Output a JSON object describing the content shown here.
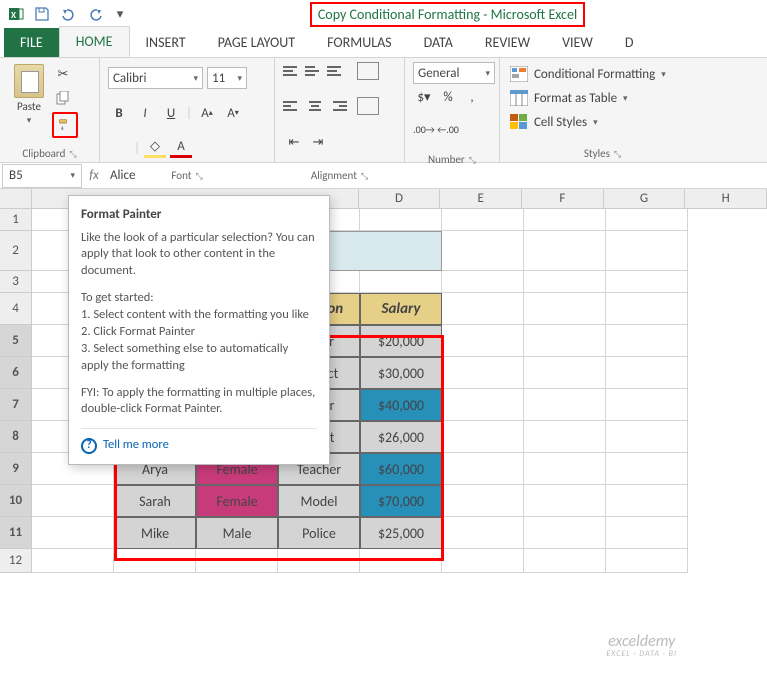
{
  "app": {
    "title": "Copy Conditional Formatting - Microsoft Excel"
  },
  "tabs": {
    "file": "FILE",
    "home": "HOME",
    "insert": "INSERT",
    "pagelayout": "PAGE LAYOUT",
    "formulas": "FORMULAS",
    "data": "DATA",
    "review": "REVIEW",
    "view": "VIEW",
    "d": "D"
  },
  "ribbon": {
    "paste": "Paste",
    "clipboard": "Clipboard",
    "font": "Font",
    "alignment": "Alignment",
    "number": "Number",
    "styles": "Styles",
    "fontname": "Calibri",
    "fontsize": "11",
    "numfmt": "General",
    "condfmt": "Conditional Formatting",
    "fmttable": "Format as Table",
    "cellstyles": "Cell Styles"
  },
  "fx": {
    "cellref": "B5",
    "value": "Alice"
  },
  "cols": [
    "D",
    "E",
    "F",
    "G",
    "H"
  ],
  "rownums": [
    "1",
    "2",
    "3",
    "4",
    "5",
    "6",
    "7",
    "8",
    "9",
    "10",
    "11",
    "12"
  ],
  "sheet": {
    "title": "Formatting",
    "headers": {
      "occ": "upation",
      "sal": "Salary"
    },
    "rows": [
      {
        "name": "",
        "gender": "",
        "occ": "octor",
        "sal": "$20,000"
      },
      {
        "name": "",
        "gender": "",
        "occ": "chitect",
        "sal": "$30,000"
      },
      {
        "name": "",
        "gender": "",
        "occ": "Actor",
        "sal": "$40,000",
        "salblue": true
      },
      {
        "name": "",
        "gender": "",
        "occ": "Artist",
        "sal": "$26,000"
      },
      {
        "name": "Arya",
        "gender": "Female",
        "genderpink": true,
        "occ": "Teacher",
        "sal": "$60,000",
        "salblue": true
      },
      {
        "name": "Sarah",
        "gender": "Female",
        "genderpink": true,
        "occ": "Model",
        "sal": "$70,000",
        "salblue": true
      },
      {
        "name": "Mike",
        "gender": "Male",
        "occ": "Police",
        "sal": "$25,000"
      }
    ]
  },
  "tooltip": {
    "title": "Format Painter",
    "p1": "Like the look of a particular selection? You can apply that look to other content in the document.",
    "p2a": "To get started:",
    "p2b": "1. Select content with the formatting you like",
    "p2c": "2. Click Format Painter",
    "p2d": "3. Select something else to automatically apply the formatting",
    "p3": "FYI: To apply the formatting in multiple places, double-click Format Painter.",
    "tell": "Tell me more"
  },
  "watermark": {
    "l1": "exceldemy",
    "l2": "EXCEL · DATA · BI"
  }
}
